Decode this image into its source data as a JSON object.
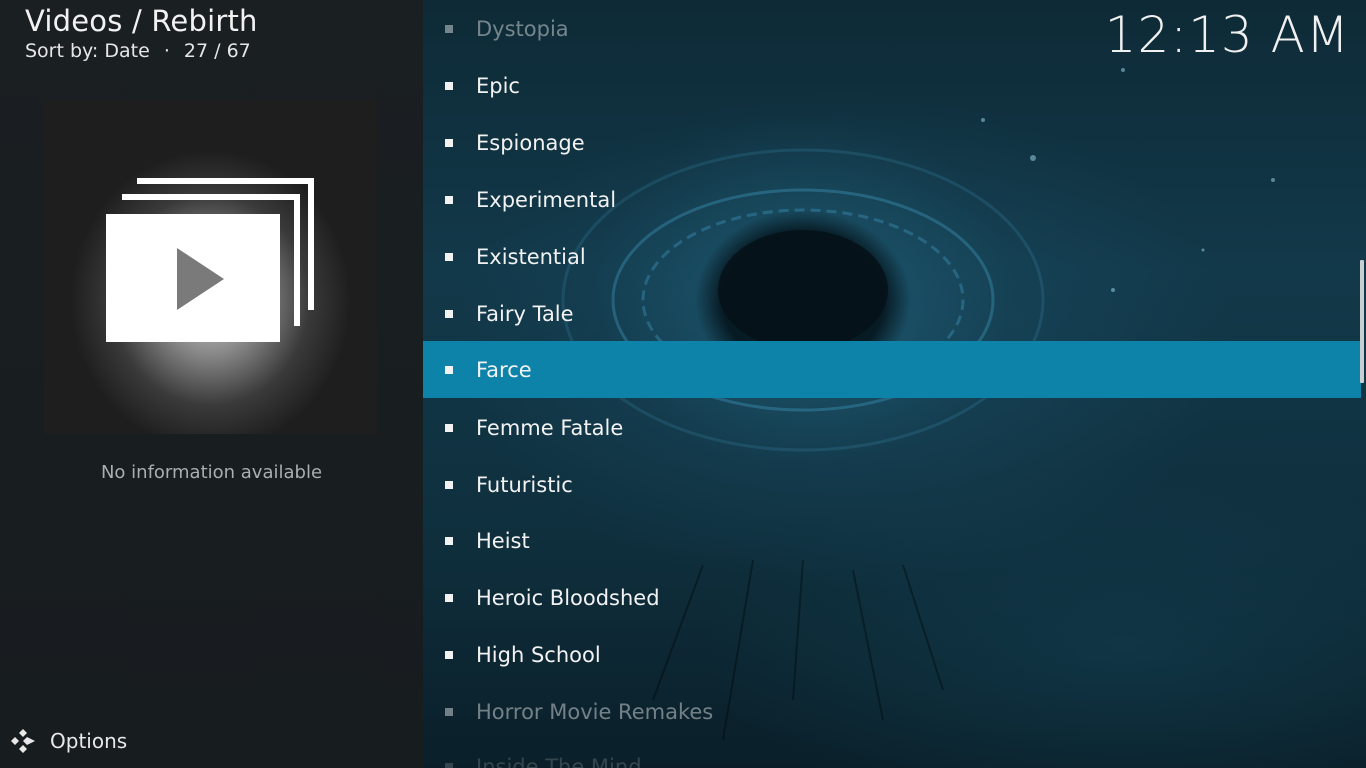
{
  "header": {
    "title": "Videos / Rebirth",
    "sort_label": "Sort by: Date",
    "separator": "·",
    "position": "27 / 67"
  },
  "clock": "12:13 AM",
  "info": {
    "no_info": "No information available",
    "thumbnail_icon": "video-playlist-icon"
  },
  "footer": {
    "options_label": "Options",
    "options_icon": "kodi-logo-icon"
  },
  "list": {
    "items": [
      {
        "label": "Dystopia",
        "state": "dim"
      },
      {
        "label": "Epic",
        "state": "normal"
      },
      {
        "label": "Espionage",
        "state": "normal"
      },
      {
        "label": "Experimental",
        "state": "normal"
      },
      {
        "label": "Existential",
        "state": "normal"
      },
      {
        "label": "Fairy Tale",
        "state": "normal"
      },
      {
        "label": "Farce",
        "state": "selected"
      },
      {
        "label": "Femme Fatale",
        "state": "normal"
      },
      {
        "label": "Futuristic",
        "state": "normal"
      },
      {
        "label": "Heist",
        "state": "normal"
      },
      {
        "label": "Heroic Bloodshed",
        "state": "normal"
      },
      {
        "label": "High School",
        "state": "normal"
      },
      {
        "label": "Horror Movie Remakes",
        "state": "dim"
      },
      {
        "label": "Inside The Mind",
        "state": "faint"
      }
    ]
  },
  "colors": {
    "selection": "#0e83aa",
    "left_panel": "#1a1f22",
    "text": "#f2f2f2"
  }
}
